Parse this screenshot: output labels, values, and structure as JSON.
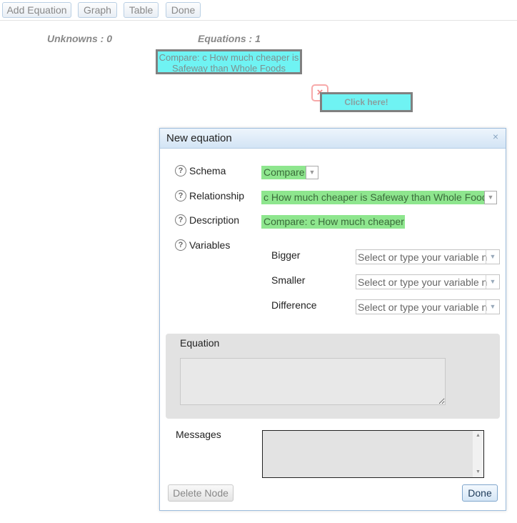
{
  "toolbar": {
    "add_equation": "Add Equation",
    "graph": "Graph",
    "table": "Table",
    "done": "Done"
  },
  "counters": {
    "unknowns": "Unknowns : 0",
    "equations": "Equations : 1"
  },
  "canvas": {
    "node_text": "Compare: c How much cheaper is Safeway than Whole Foods",
    "close_icon": "×",
    "click_here": "Click here!"
  },
  "dialog": {
    "title": "New equation",
    "close_icon": "×",
    "help_icon": "?",
    "schema": {
      "label": "Schema",
      "value": "Compare"
    },
    "relationship": {
      "label": "Relationship",
      "value": "c How much cheaper is Safeway than Whole Foods"
    },
    "description": {
      "label": "Description",
      "value": "Compare: c How much cheaper is Safeway than Whole Foods"
    },
    "variables": {
      "label": "Variables",
      "placeholder": "Select or type your variable name",
      "items": [
        {
          "label": "Bigger"
        },
        {
          "label": "Smaller"
        },
        {
          "label": "Difference"
        }
      ]
    },
    "equation": {
      "label": "Equation",
      "value": ""
    },
    "messages": {
      "label": "Messages",
      "value": ""
    },
    "delete_button": "Delete Node",
    "done_button": "Done"
  },
  "icons": {
    "dropdown": "chevron-down-icon",
    "help": "question-circle-icon",
    "close": "close-icon"
  },
  "colors": {
    "node_fill": "#6ff3f3",
    "green_field": "#8ee68e",
    "dialog_title_bar": "#d3e4f5"
  }
}
